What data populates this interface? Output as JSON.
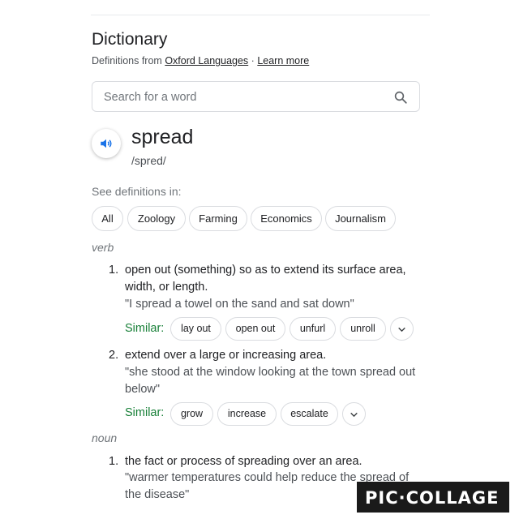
{
  "header": {
    "title": "Dictionary",
    "source_prefix": "Definitions from",
    "source_link": "Oxford Languages",
    "separator": "·",
    "learn_more": "Learn more"
  },
  "search": {
    "placeholder": "Search for a word",
    "icon": "search-icon"
  },
  "entry": {
    "word": "spread",
    "phonetic": "/spred/",
    "audio_icon": "speaker-icon"
  },
  "see_definitions": {
    "label": "See definitions in:",
    "chips": [
      "All",
      "Zoology",
      "Farming",
      "Economics",
      "Journalism"
    ]
  },
  "senses": [
    {
      "pos": "verb",
      "definitions": [
        {
          "number": "1.",
          "line1": "open out (something) so as to extend its surface area,",
          "line2": "width, or length.",
          "example": "\"I spread a towel on the sand and sat down\"",
          "similar_label": "Similar:",
          "similar": [
            "lay out",
            "open out",
            "unfurl",
            "unroll"
          ]
        },
        {
          "number": "2.",
          "line1": "extend over a large or increasing area.",
          "example_line1": "\"she stood at the window looking at the town spread out",
          "example_line2": "below\"",
          "similar_label": "Similar:",
          "similar": [
            "grow",
            "increase",
            "escalate"
          ]
        }
      ]
    },
    {
      "pos": "noun",
      "definitions": [
        {
          "number": "1.",
          "line1": "the fact or process of spreading over an area.",
          "example_line1": "\"warmer temperatures could help reduce the spread of",
          "example_line2": "the disease\""
        }
      ]
    }
  ],
  "watermark": "PIC·COLLAGE",
  "colors": {
    "accent_blue": "#1a73e8",
    "similar_green": "#188038",
    "border": "#dadce0"
  }
}
